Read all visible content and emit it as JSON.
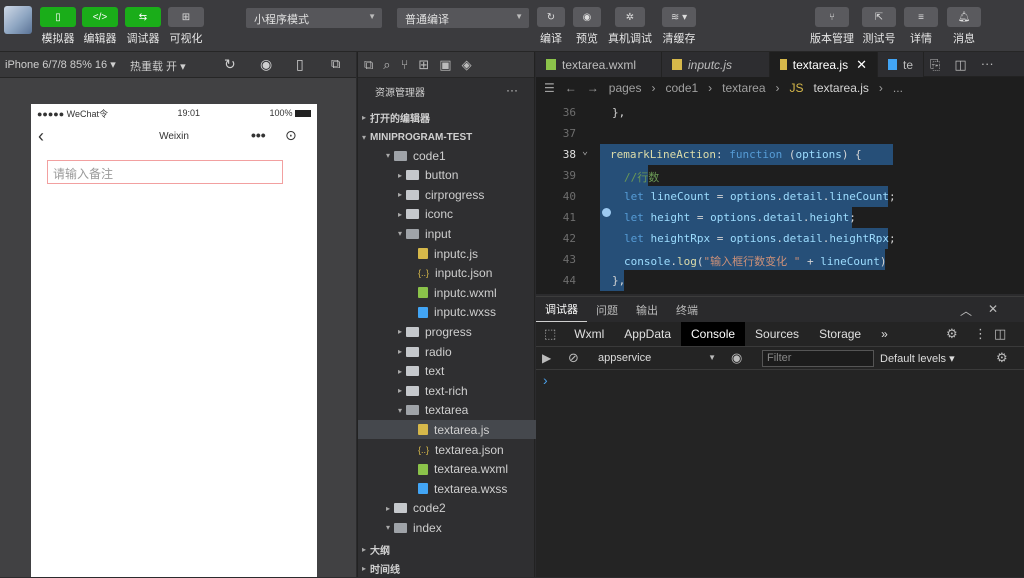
{
  "toolbar": {
    "buttons": [
      {
        "label": "模拟器",
        "icon": "phone-icon"
      },
      {
        "label": "编辑器",
        "icon": "code-icon"
      },
      {
        "label": "调试器",
        "icon": "debug-icon"
      },
      {
        "label": "可视化",
        "icon": "layout-icon"
      }
    ],
    "mode_select": "小程序模式",
    "compile_select": "普通编译",
    "actions": [
      {
        "label": "编译",
        "icon": "refresh-icon"
      },
      {
        "label": "预览",
        "icon": "eye-icon"
      },
      {
        "label": "真机调试",
        "icon": "bug-icon"
      },
      {
        "label": "清缓存",
        "icon": "layers-icon"
      }
    ],
    "right_actions": [
      {
        "label": "版本管理",
        "icon": "branch-icon"
      },
      {
        "label": "测试号",
        "icon": "external-link-icon"
      },
      {
        "label": "详情",
        "icon": "menu-icon"
      },
      {
        "label": "消息",
        "icon": "bell-icon"
      }
    ]
  },
  "simulator": {
    "device": "iPhone 6/7/8 85% 16 ▾",
    "hot_reload": "热重载 开 ▾",
    "status_left": "●●●●● WeChat令",
    "status_time": "19:01",
    "status_battery": "100%",
    "nav_title": "Weixin",
    "input_placeholder": "请输入备注"
  },
  "explorer": {
    "title": "资源管理器",
    "open_editors": "打开的编辑器",
    "project": "MINIPROGRAM-TEST",
    "items": [
      {
        "label": "code1",
        "type": "open",
        "depth": 1,
        "arrow": "▾"
      },
      {
        "label": "button",
        "type": "folder",
        "depth": 2,
        "arrow": "▸"
      },
      {
        "label": "cirprogress",
        "type": "folder",
        "depth": 2,
        "arrow": "▸"
      },
      {
        "label": "iconc",
        "type": "folder",
        "depth": 2,
        "arrow": "▸"
      },
      {
        "label": "input",
        "type": "open",
        "depth": 2,
        "arrow": "▾"
      },
      {
        "label": "inputc.js",
        "type": "js",
        "depth": 3,
        "arrow": ""
      },
      {
        "label": "inputc.json",
        "type": "json",
        "depth": 3,
        "arrow": ""
      },
      {
        "label": "inputc.wxml",
        "type": "wxml",
        "depth": 3,
        "arrow": ""
      },
      {
        "label": "inputc.wxss",
        "type": "wxss",
        "depth": 3,
        "arrow": ""
      },
      {
        "label": "progress",
        "type": "folder",
        "depth": 2,
        "arrow": "▸"
      },
      {
        "label": "radio",
        "type": "folder",
        "depth": 2,
        "arrow": "▸"
      },
      {
        "label": "text",
        "type": "folder",
        "depth": 2,
        "arrow": "▸"
      },
      {
        "label": "text-rich",
        "type": "folder",
        "depth": 2,
        "arrow": "▸"
      },
      {
        "label": "textarea",
        "type": "open",
        "depth": 2,
        "arrow": "▾"
      },
      {
        "label": "textarea.js",
        "type": "js",
        "depth": 3,
        "arrow": "",
        "selected": true
      },
      {
        "label": "textarea.json",
        "type": "json",
        "depth": 3,
        "arrow": ""
      },
      {
        "label": "textarea.wxml",
        "type": "wxml",
        "depth": 3,
        "arrow": ""
      },
      {
        "label": "textarea.wxss",
        "type": "wxss",
        "depth": 3,
        "arrow": ""
      },
      {
        "label": "code2",
        "type": "folder",
        "depth": 1,
        "arrow": "▸"
      },
      {
        "label": "index",
        "type": "open",
        "depth": 1,
        "arrow": "▾"
      }
    ],
    "outline": "大纲",
    "timeline": "时间线"
  },
  "editor": {
    "tabs": [
      {
        "label": "textarea.wxml",
        "icon": "wxml"
      },
      {
        "label": "inputc.js",
        "icon": "js"
      },
      {
        "label": "textarea.js",
        "icon": "js",
        "active": true
      },
      {
        "label": "te",
        "icon": "wxss"
      }
    ],
    "breadcrumb": [
      "pages",
      "code1",
      "textarea",
      "textarea.js",
      "..."
    ],
    "line_numbers": [
      "36",
      "37",
      "38",
      "39",
      "40",
      "41",
      "42",
      "43",
      "44"
    ]
  },
  "devtools": {
    "tabs": [
      "调试器",
      "问题",
      "输出",
      "终端"
    ],
    "panels": [
      "Wxml",
      "AppData",
      "Console",
      "Sources",
      "Storage",
      "»"
    ],
    "context": "appservice",
    "filter_placeholder": "Filter",
    "levels": "Default levels ▾",
    "prompt": "›"
  }
}
